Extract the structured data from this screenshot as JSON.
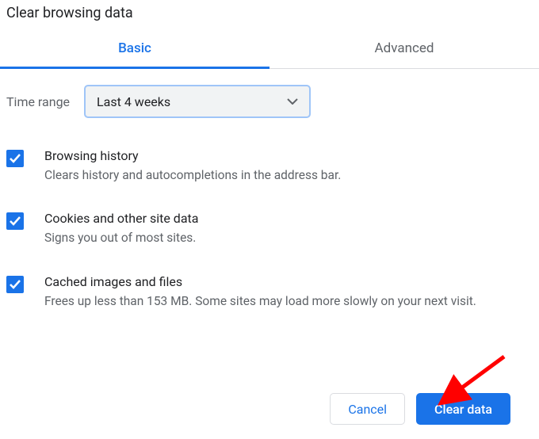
{
  "title": "Clear browsing data",
  "tabs": {
    "basic": "Basic",
    "advanced": "Advanced",
    "active": "basic"
  },
  "timeRange": {
    "label": "Time range",
    "value": "Last 4 weeks"
  },
  "options": [
    {
      "checked": true,
      "title": "Browsing history",
      "desc": "Clears history and autocompletions in the address bar."
    },
    {
      "checked": true,
      "title": "Cookies and other site data",
      "desc": "Signs you out of most sites."
    },
    {
      "checked": true,
      "title": "Cached images and files",
      "desc": "Frees up less than 153 MB. Some sites may load more slowly on your next visit."
    }
  ],
  "buttons": {
    "cancel": "Cancel",
    "clear": "Clear data"
  },
  "colors": {
    "accent": "#1a73e8",
    "muted": "#5f6368",
    "arrow": "#ff0000"
  }
}
